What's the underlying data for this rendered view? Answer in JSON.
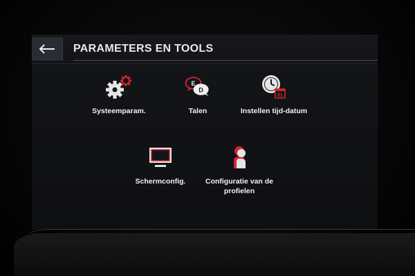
{
  "header": {
    "title": "PARAMETERS EN TOOLS",
    "back_icon": "back-arrow-icon"
  },
  "tiles": [
    {
      "label": "Systeemparam.",
      "icon": "gears-icon"
    },
    {
      "label": "Talen",
      "icon": "language-bubbles-icon"
    },
    {
      "label": "Instellen tijd-datum",
      "icon": "clock-calendar-icon"
    },
    {
      "label": "Schermconfig.",
      "icon": "monitor-icon"
    },
    {
      "label": "Configuratie van de profielen",
      "icon": "profile-icon"
    }
  ],
  "language_icon_letters": {
    "a": "E",
    "b": "D"
  },
  "calendar_digits": "01",
  "colors": {
    "accent": "#d6232e",
    "text": "#f2f2f2",
    "background": "#121317"
  }
}
